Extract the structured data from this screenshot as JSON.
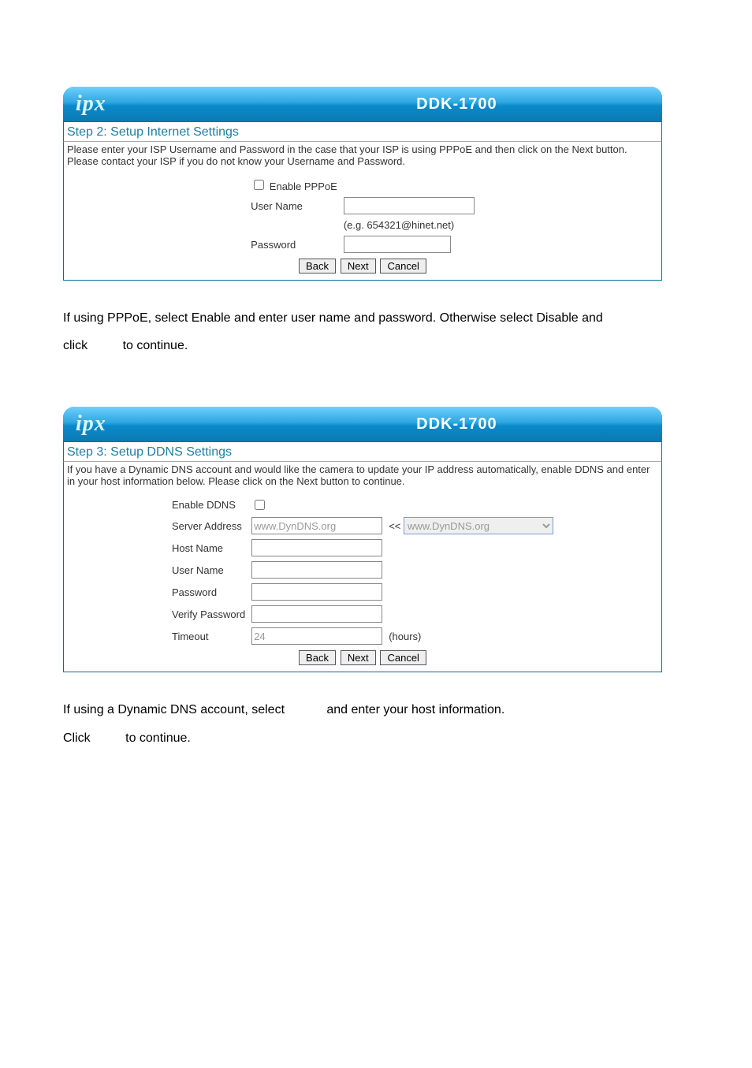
{
  "logo": "ipx",
  "model": "DDK-1700",
  "panel1": {
    "step_title": "Step 2: Setup Internet Settings",
    "desc": "Please enter your ISP Username and Password in the case that your ISP is using PPPoE and then click on the Next button. Please contact your ISP if you do not know your Username and Password.",
    "enable_label": "Enable PPPoE",
    "username_label": "User Name",
    "username_hint": "(e.g. 654321@hinet.net)",
    "password_label": "Password",
    "back": "Back",
    "next": "Next",
    "cancel": "Cancel"
  },
  "doc1_line1": "If using PPPoE, select Enable and enter user name and password. Otherwise select Disable and",
  "doc1_line2_a": "click ",
  "doc1_line2_b": " to continue.",
  "panel2": {
    "step_title": "Step 3: Setup DDNS Settings",
    "desc": "If you have a Dynamic DNS account and would like the camera to update your IP address automatically, enable DDNS and enter in your host information below. Please click on the Next button to continue.",
    "enable_label": "Enable DDNS",
    "server_label": "Server Address",
    "server_value": "www.DynDNS.org",
    "server_select": "www.DynDNS.org",
    "arrow": "<<",
    "host_label": "Host Name",
    "username_label": "User Name",
    "password_label": "Password",
    "verify_label": "Verify Password",
    "timeout_label": "Timeout",
    "timeout_value": "24",
    "timeout_unit": "(hours)",
    "back": "Back",
    "next": "Next",
    "cancel": "Cancel"
  },
  "doc2_line1_a": "If using a Dynamic DNS account, select ",
  "doc2_line1_b": " and enter your host information.",
  "doc2_line2_a": "Click ",
  "doc2_line2_b": " to continue."
}
